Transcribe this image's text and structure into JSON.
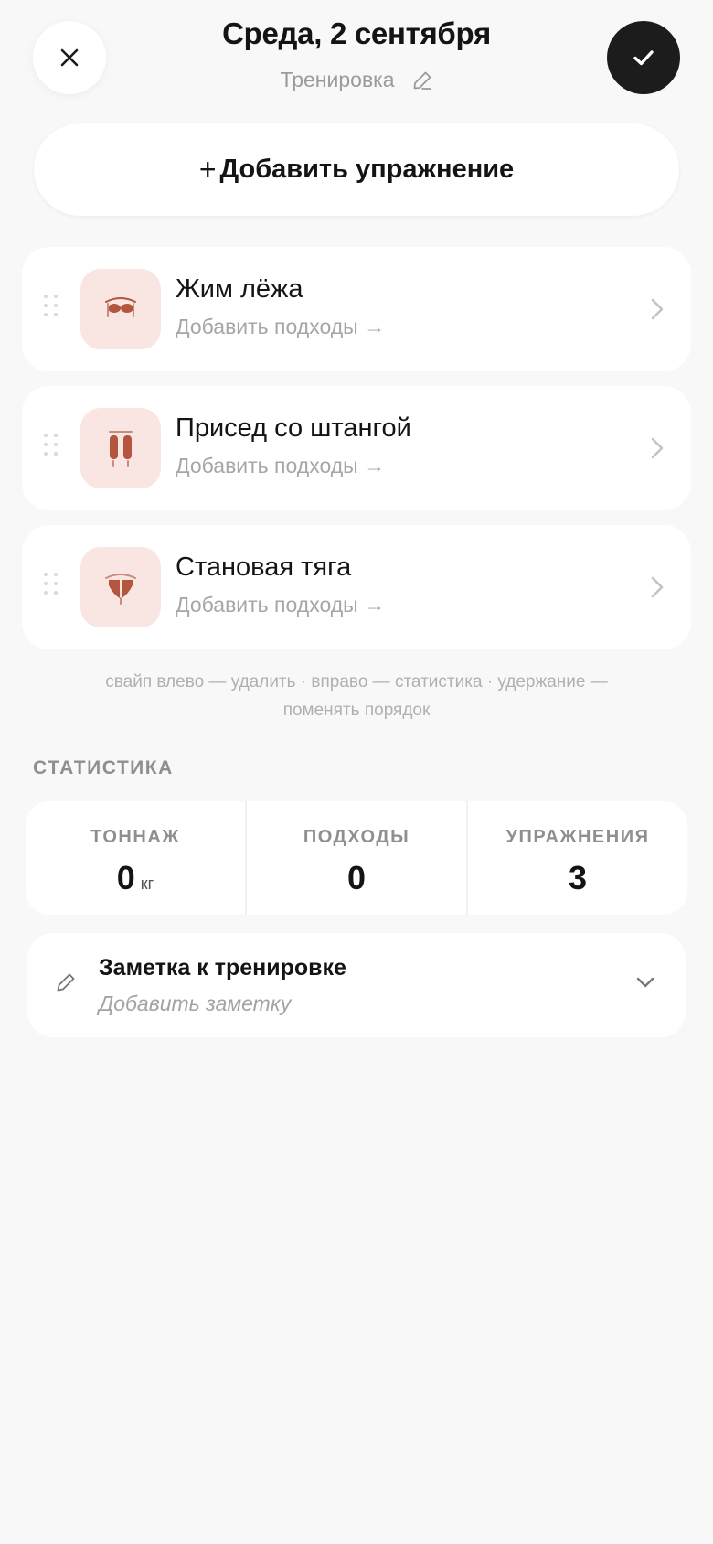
{
  "header": {
    "title": "Среда, 2 сентября",
    "subtitle": "Тренировка"
  },
  "add_exercise": {
    "plus": "+",
    "label": "Добавить упражнение"
  },
  "exercises": [
    {
      "name": "Жим лёжа",
      "sub": "Добавить подходы →",
      "icon": "chest-muscle-icon"
    },
    {
      "name": "Присед со штангой",
      "sub": "Добавить подходы →",
      "icon": "legs-muscle-icon"
    },
    {
      "name": "Становая тяга",
      "sub": "Добавить подходы →",
      "icon": "back-muscle-icon"
    }
  ],
  "hint": {
    "line1": "свайп влево — удалить · вправо — статистика · удержание —",
    "line2": "поменять порядок"
  },
  "stats": {
    "section_title": "СТАТИСТИКА",
    "items": [
      {
        "label": "ТОННАЖ",
        "value": "0",
        "unit": "кг"
      },
      {
        "label": "ПОДХОДЫ",
        "value": "0",
        "unit": ""
      },
      {
        "label": "УПРАЖНЕНИЯ",
        "value": "3",
        "unit": ""
      }
    ]
  },
  "note": {
    "title": "Заметка к тренировке",
    "placeholder": "Добавить заметку"
  },
  "colors": {
    "accent_dark": "#1c1c1c",
    "muscle": "#b4563e",
    "thumb_bg": "#f9e6e2",
    "background": "#f8f8f8"
  }
}
